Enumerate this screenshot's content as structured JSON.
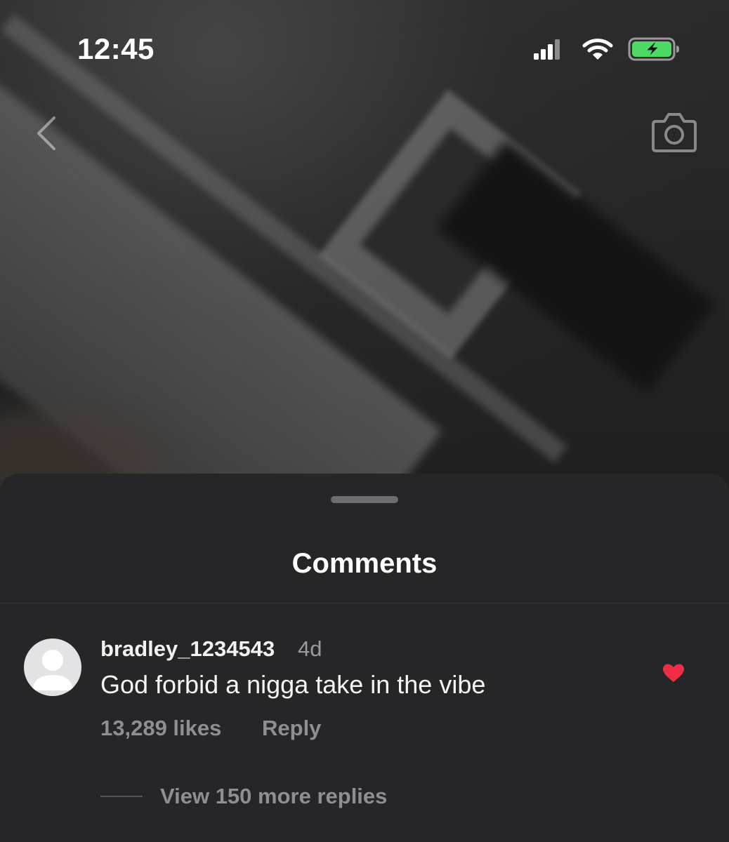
{
  "status_bar": {
    "time": "12:45"
  },
  "sheet": {
    "title": "Comments"
  },
  "comment": {
    "username": "bradley_1234543",
    "time_ago": "4d",
    "text": "God forbid a nigga take in the vibe",
    "likes": "13,289 likes",
    "reply_label": "Reply",
    "liked": true,
    "view_replies_label": "View 150 more replies"
  },
  "icons": {
    "back": "chevron-left-icon",
    "camera": "camera-icon",
    "like": "heart-icon",
    "signal": "cellular-signal-icon",
    "wifi": "wifi-icon",
    "battery": "battery-charging-icon"
  },
  "colors": {
    "sheet_background": "#262628",
    "like_red": "#ed2e45",
    "battery_green": "#4cd964",
    "secondary_text": "#8e8e93"
  }
}
